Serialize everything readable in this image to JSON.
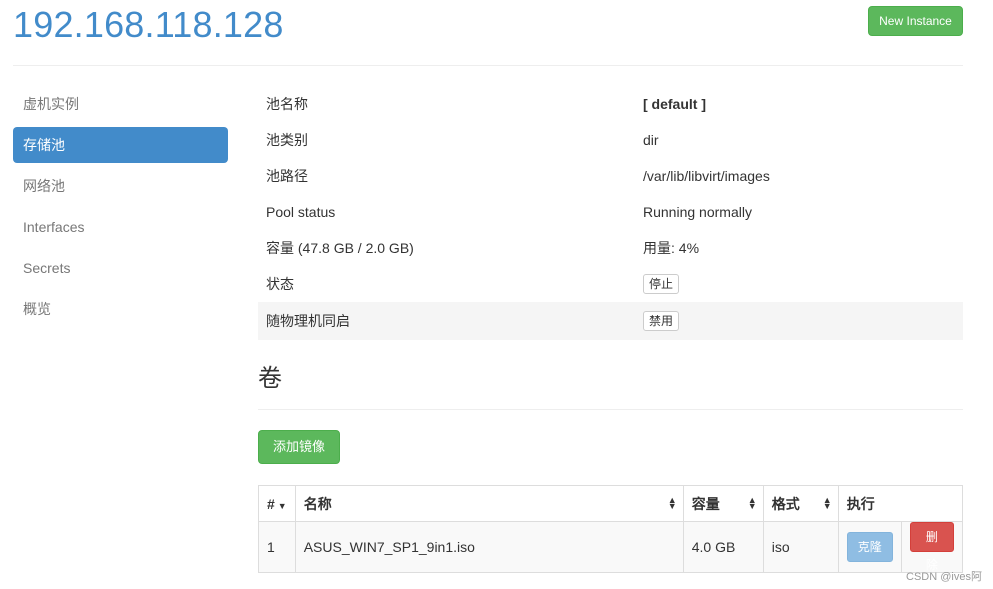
{
  "header": {
    "host": "192.168.118.128",
    "new_instance_label": "New Instance"
  },
  "sidebar": {
    "items": [
      {
        "label": "虚机实例",
        "active": false
      },
      {
        "label": "存储池",
        "active": true
      },
      {
        "label": "网络池",
        "active": false
      },
      {
        "label": "Interfaces",
        "active": false
      },
      {
        "label": "Secrets",
        "active": false
      },
      {
        "label": "概览",
        "active": false
      }
    ]
  },
  "pool": {
    "name_label": "池名称",
    "name_value": "[ default ]",
    "type_label": "池类别",
    "type_value": "dir",
    "path_label": "池路径",
    "path_value": "/var/lib/libvirt/images",
    "status_label": "Pool status",
    "status_value": "Running normally",
    "capacity_label": "容量 (47.8 GB / 2.0 GB)",
    "usage_value": "用量: 4%",
    "state_label": "状态",
    "stop_button": "停止",
    "autostart_label": "随物理机同启",
    "disable_button": "禁用"
  },
  "volumes": {
    "title": "卷",
    "add_button": "添加镜像",
    "columns": [
      "#",
      "名称",
      "容量",
      "格式",
      "执行"
    ],
    "rows": [
      {
        "index": "1",
        "name": "ASUS_WIN7_SP1_9in1.iso",
        "size": "4.0 GB",
        "format": "iso",
        "clone_label": "克隆",
        "delete_label": "删除"
      }
    ]
  },
  "watermark": "CSDN @ives阿"
}
